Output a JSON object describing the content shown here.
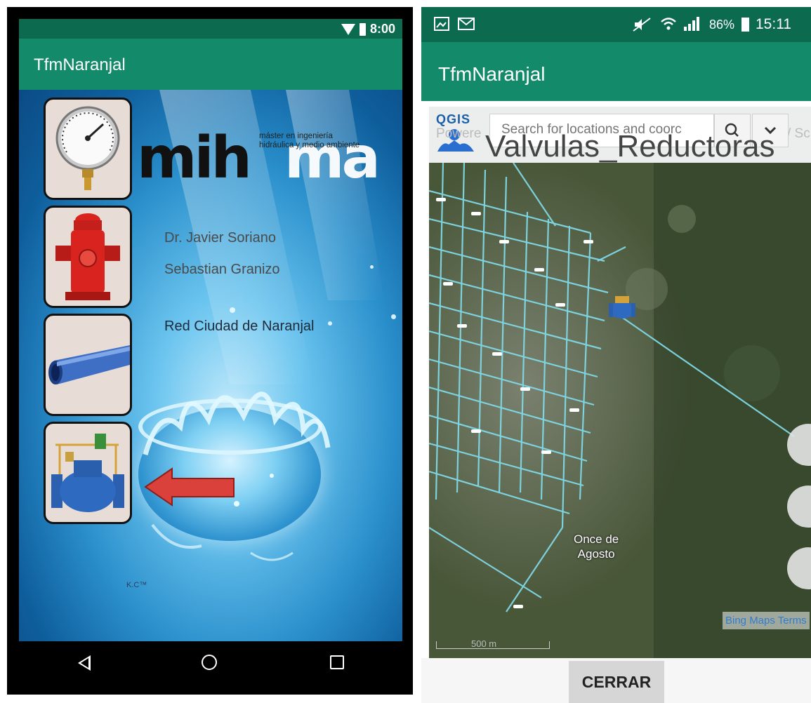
{
  "left_phone": {
    "status_bar": {
      "time": "8:00"
    },
    "app_bar": {
      "title": "TfmNaranjal"
    },
    "splash": {
      "logo_part1": "mih",
      "logo_part2": "ma",
      "tagline_line1": "máster en ingeniería",
      "tagline_line2": "hidráulica y medio ambiente",
      "author1": "Dr. Javier Soriano",
      "author2": "Sebastian Granizo",
      "network_title": "Red Ciudad de Naranjal",
      "watermark": "K.C™"
    },
    "menu_tiles": [
      {
        "icon": "pressure-gauge-icon"
      },
      {
        "icon": "fire-hydrant-icon"
      },
      {
        "icon": "pipe-icon"
      },
      {
        "icon": "pressure-reducing-valve-icon"
      }
    ],
    "nav_bar": {
      "back": "back-icon",
      "home": "home-icon",
      "recent": "recent-apps-icon"
    }
  },
  "right_phone": {
    "status_bar": {
      "battery": "86%",
      "time": "15:11"
    },
    "app_bar": {
      "title": "TfmNaranjal"
    },
    "map": {
      "search_placeholder": "Search for locations and coorc",
      "qgis_label": "QGIS",
      "layer_title": "Valvulas_Reductoras",
      "place_label_line1": "Once de",
      "place_label_line2": "Agosto",
      "attribution": "Bing Maps Terms",
      "scale": "500 m",
      "overlap_text_left": "Powere",
      "overlap_text_right": "/ Sc"
    },
    "close_button": "CERRAR"
  },
  "colors": {
    "status_bar": "#0c6b4f",
    "app_bar": "#138a6a",
    "network_lines": "#7fd8e6",
    "arrow": "#d9413a"
  }
}
